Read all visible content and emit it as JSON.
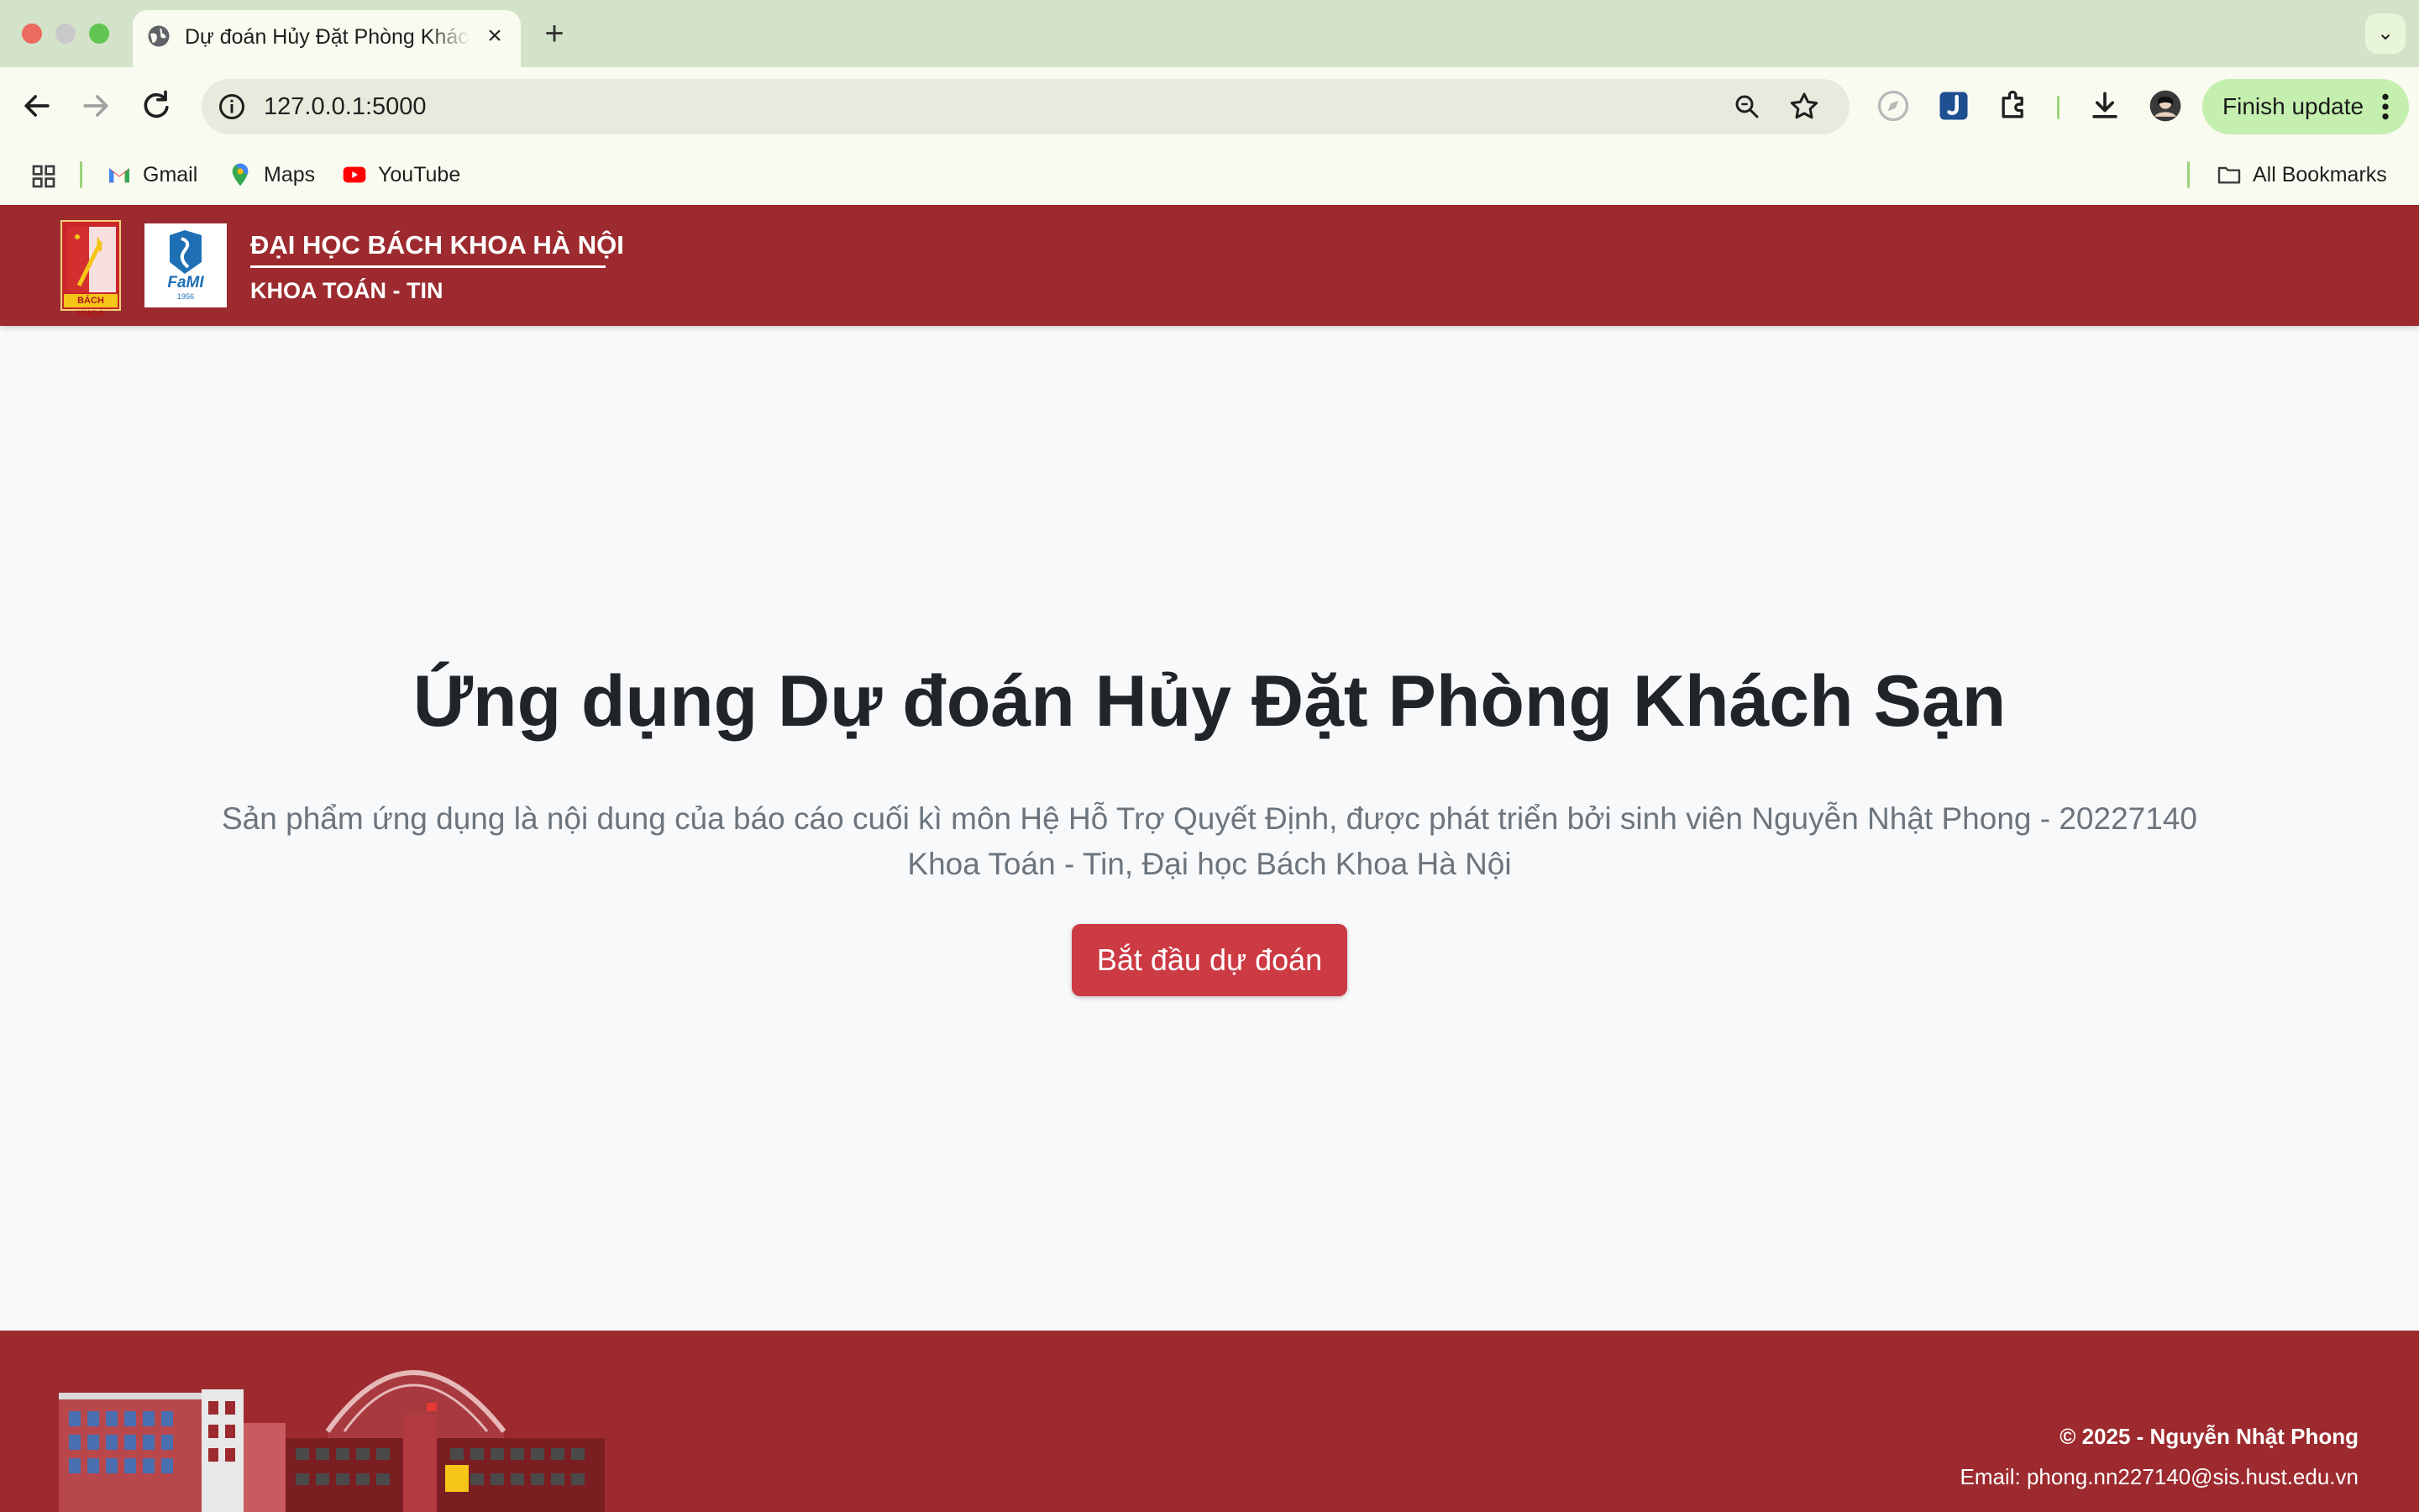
{
  "browser": {
    "tab_title": "Dự đoán Hủy Đặt Phòng Khách Sạn",
    "url": "127.0.0.1:5000",
    "finish_update_label": "Finish update",
    "bookmarks": [
      {
        "label": "Gmail",
        "icon": "gmail-icon"
      },
      {
        "label": "Maps",
        "icon": "maps-icon"
      },
      {
        "label": "YouTube",
        "icon": "youtube-icon"
      }
    ],
    "all_bookmarks_label": "All Bookmarks"
  },
  "header": {
    "university": "ĐẠI HỌC BÁCH KHOA HÀ NỘI",
    "department": "KHOA TOÁN - TIN",
    "logo_bk_text": "BÁCH KHOA",
    "logo_fami_text": "FaMI",
    "logo_fami_year": "1956"
  },
  "hero": {
    "title": "Ứng dụng Dự đoán Hủy Đặt Phòng Khách Sạn",
    "description_line1": "Sản phẩm ứng dụng là nội dung của báo cáo cuối kì môn Hệ Hỗ Trợ Quyết Định, được phát triển bởi sinh viên Nguyễn Nhật Phong - 20227140",
    "description_line2": "Khoa Toán - Tin, Đại học Bách Khoa Hà Nội",
    "button_label": "Bắt đầu dự đoán"
  },
  "footer": {
    "copyright": "© 2025 - Nguyễn Nhật Phong",
    "email": "Email: phong.nn227140@sis.hust.edu.vn"
  },
  "colors": {
    "brand_red": "#9c2a2e",
    "button_red": "#cc3a44",
    "page_bg": "#f8f9fa",
    "chrome_green": "#d3e3c9"
  }
}
